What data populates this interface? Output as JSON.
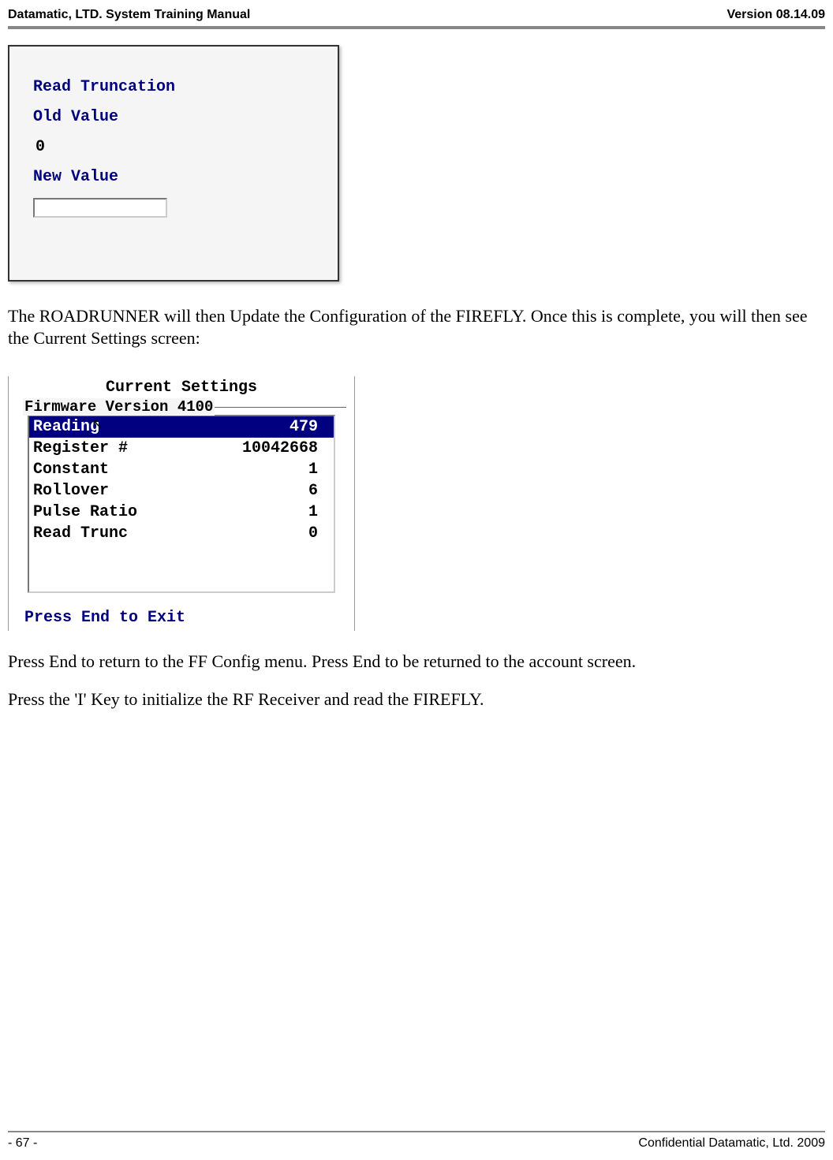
{
  "header": {
    "left": "Datamatic, LTD. System Training  Manual",
    "right": "Version 08.14.09"
  },
  "dialog1": {
    "title": "Read Truncation",
    "old_label": "Old Value",
    "old_value": "0",
    "new_label": "New Value"
  },
  "para1": "The ROADRUNNER will then Update the Configuration of the FIREFLY. Once this is complete, you will then see the Current Settings screen:",
  "dialog2": {
    "header": "Current Settings",
    "firmware": "Firmware Version 4100",
    "rows": [
      {
        "label": "Reading",
        "value": "479",
        "highlight": true
      },
      {
        "label": "Register #",
        "value": "10042668",
        "highlight": false
      },
      {
        "label": "Constant",
        "value": "1",
        "highlight": false
      },
      {
        "label": "Rollover",
        "value": "6",
        "highlight": false
      },
      {
        "label": "Pulse Ratio",
        "value": "1",
        "highlight": false
      },
      {
        "label": "Read Trunc",
        "value": "0",
        "highlight": false
      }
    ],
    "footer": "Press End to Exit"
  },
  "para2": "Press End to return to the FF Config menu. Press End to be returned to the account screen.",
  "para3": "Press the 'I' Key to initialize the RF Receiver and read the FIREFLY.",
  "footer": {
    "left": "- 67 -",
    "right": "Confidential Datamatic, Ltd. 2009"
  }
}
